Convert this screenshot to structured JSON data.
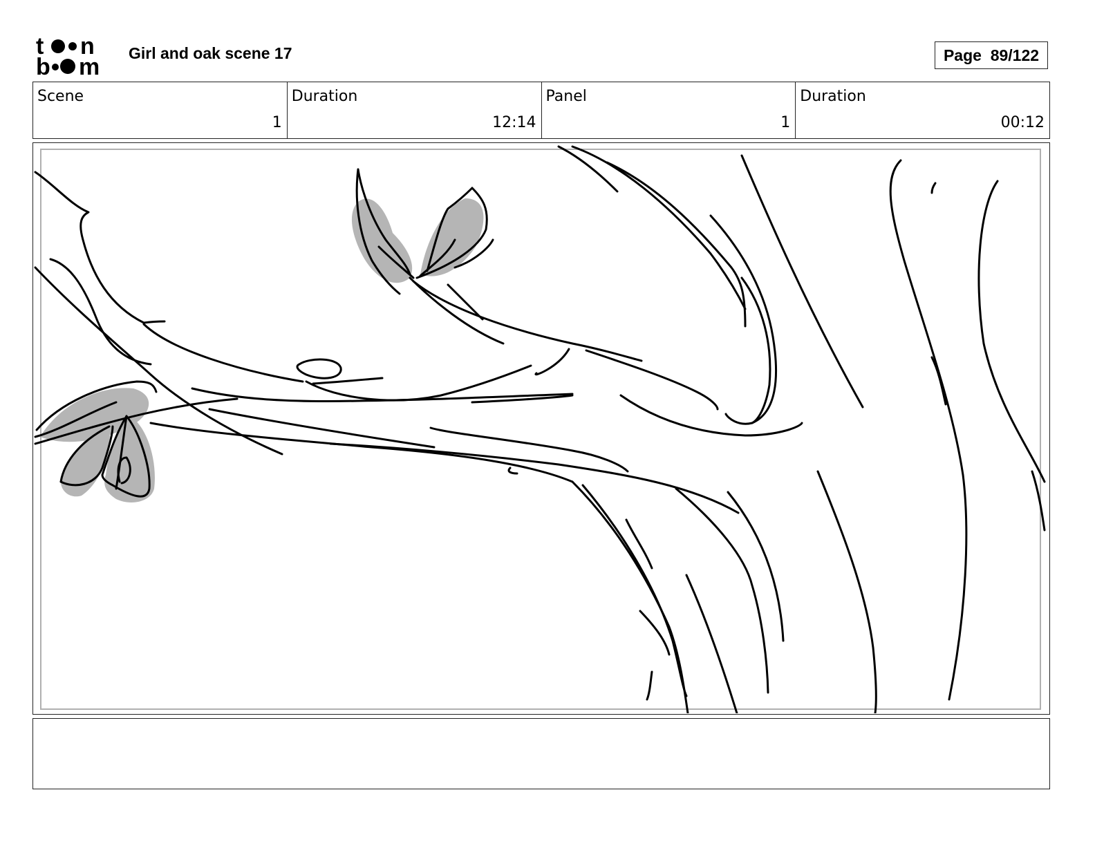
{
  "header": {
    "logo_text": "toon boom",
    "title": "Girl and oak scene 17",
    "page_label": "Page",
    "page_number": "89/122"
  },
  "info": {
    "scene_label": "Scene",
    "scene_value": "1",
    "scene_duration_label": "Duration",
    "scene_duration_value": "12:14",
    "panel_label": "Panel",
    "panel_value": "1",
    "panel_duration_label": "Duration",
    "panel_duration_value": "00:12"
  },
  "notes": {
    "text": ""
  }
}
